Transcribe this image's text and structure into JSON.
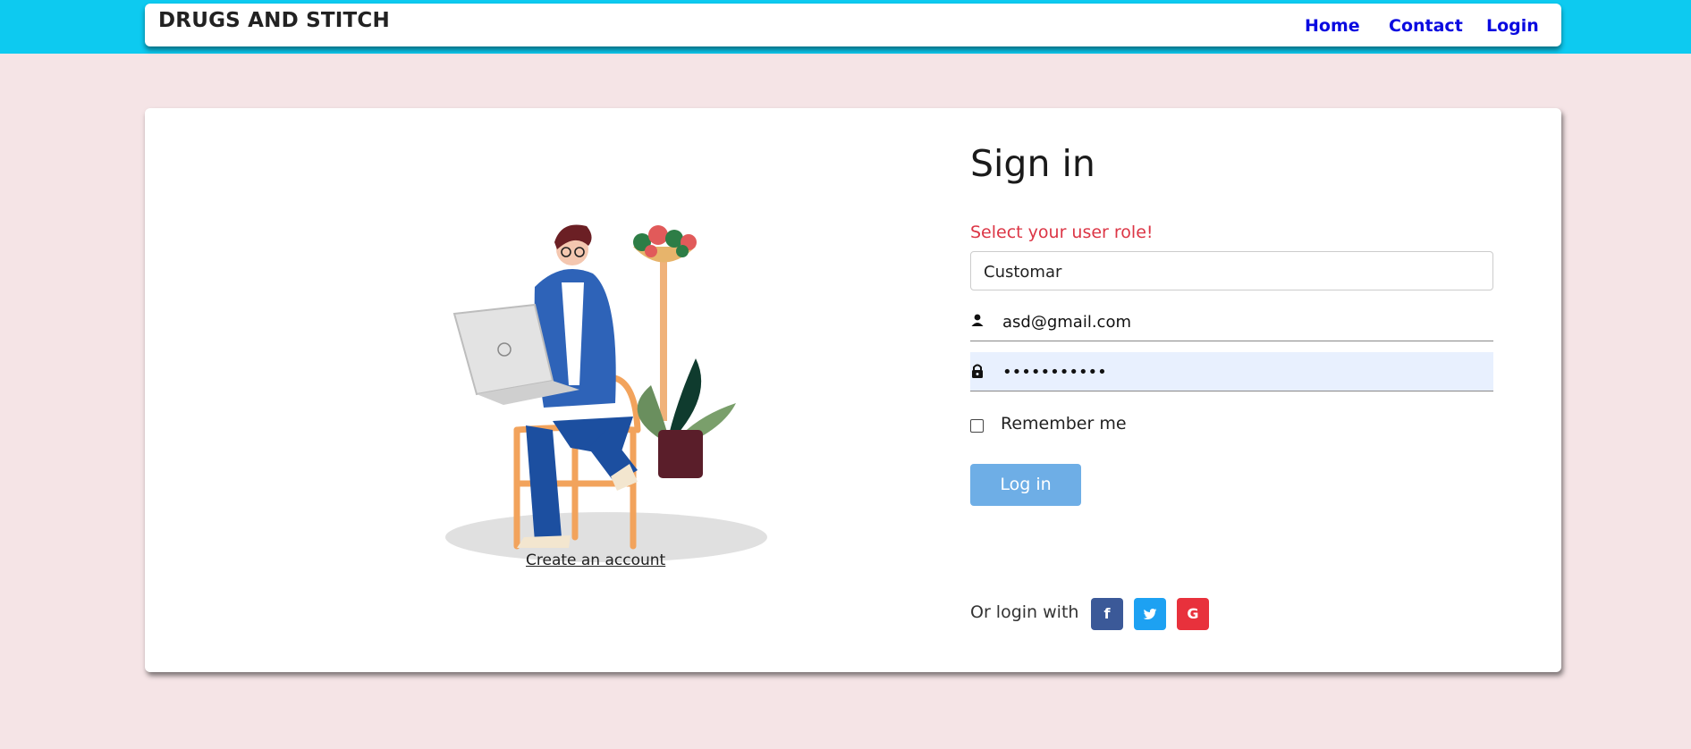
{
  "brand": "DRUGS AND STITCH",
  "nav": {
    "home": "Home",
    "contact": "Contact",
    "login": "Login"
  },
  "signin": {
    "title": "Sign in",
    "role_label": "Select your user role!",
    "role_value": "Customar",
    "email_value": "asd@gmail.com",
    "password_value": "•••••••••••",
    "remember_label": "Remember me",
    "login_button": "Log in",
    "or_login_with": "Or login with",
    "social": {
      "facebook": "f",
      "twitter": "t",
      "google": "G"
    }
  },
  "create_account_link": "Create an account",
  "colors": {
    "topbar": "#0dcaf0",
    "background": "#f5e4e6",
    "nav_link": "#0a0ae0",
    "role_label": "#dc3545",
    "login_button": "#6eaee6",
    "facebook": "#3b5998",
    "twitter": "#1da1f2",
    "google": "#e8313c"
  },
  "icons": {
    "email_field": "user-icon",
    "password_field": "lock-icon",
    "social": [
      "facebook-icon",
      "twitter-icon",
      "google-icon"
    ]
  }
}
